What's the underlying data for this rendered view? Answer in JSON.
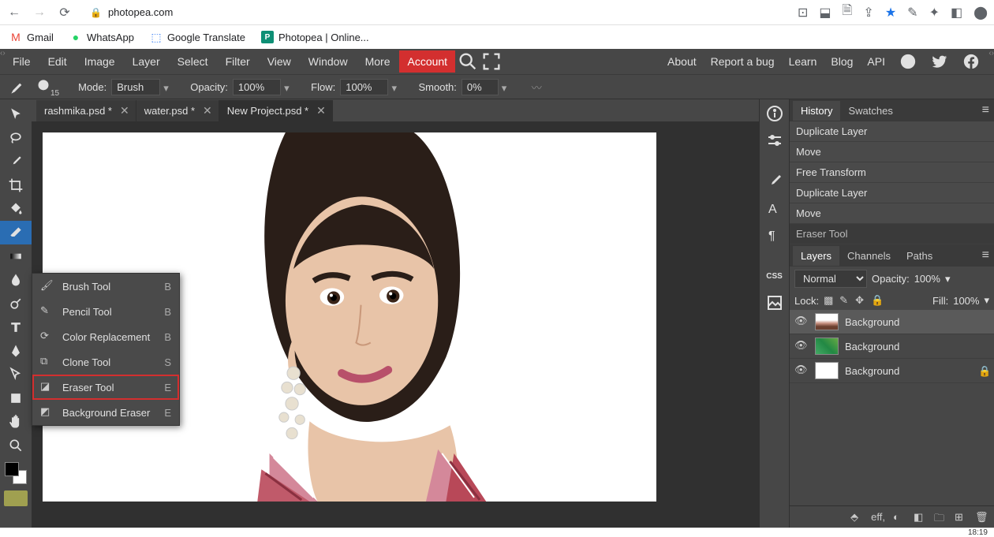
{
  "browser": {
    "url": "photopea.com",
    "bookmarks": [
      {
        "label": "Gmail",
        "icon": "gmail"
      },
      {
        "label": "WhatsApp",
        "icon": "whatsapp"
      },
      {
        "label": "Google Translate",
        "icon": "gtranslate"
      },
      {
        "label": "Photopea | Online...",
        "icon": "photopea"
      }
    ]
  },
  "menu": {
    "items": [
      "File",
      "Edit",
      "Image",
      "Layer",
      "Select",
      "Filter",
      "View",
      "Window",
      "More"
    ],
    "account": "Account",
    "right": [
      "About",
      "Report a bug",
      "Learn",
      "Blog",
      "API"
    ]
  },
  "options": {
    "brush_size": "15",
    "mode_label": "Mode:",
    "mode_value": "Brush",
    "opacity_label": "Opacity:",
    "opacity_value": "100%",
    "flow_label": "Flow:",
    "flow_value": "100%",
    "smooth_label": "Smooth:",
    "smooth_value": "0%"
  },
  "tabs": [
    {
      "name": "rashmika.psd *"
    },
    {
      "name": "water.psd *"
    },
    {
      "name": "New Project.psd *"
    }
  ],
  "context_menu": [
    {
      "label": "Brush Tool",
      "shortcut": "B"
    },
    {
      "label": "Pencil Tool",
      "shortcut": "B"
    },
    {
      "label": "Color Replacement",
      "shortcut": "B"
    },
    {
      "label": "Clone Tool",
      "shortcut": "S"
    },
    {
      "label": "Eraser Tool",
      "shortcut": "E",
      "highlight": true
    },
    {
      "label": "Background Eraser",
      "shortcut": "E"
    }
  ],
  "panels": {
    "history": {
      "tabs": [
        "History",
        "Swatches"
      ],
      "items": [
        "Duplicate Layer",
        "Move",
        "Free Transform",
        "Duplicate Layer",
        "Move",
        "Eraser Tool"
      ]
    },
    "layers": {
      "tabs": [
        "Layers",
        "Channels",
        "Paths"
      ],
      "blend": "Normal",
      "opacity_label": "Opacity:",
      "opacity_value": "100%",
      "lock_label": "Lock:",
      "fill_label": "Fill:",
      "fill_value": "100%",
      "items": [
        {
          "name": "Background",
          "locked": false,
          "thumb": "img1"
        },
        {
          "name": "Background",
          "locked": false,
          "thumb": "img2"
        },
        {
          "name": "Background",
          "locked": true,
          "thumb": "white"
        }
      ],
      "footer_eff": "eff,"
    }
  },
  "clock": "18:19"
}
